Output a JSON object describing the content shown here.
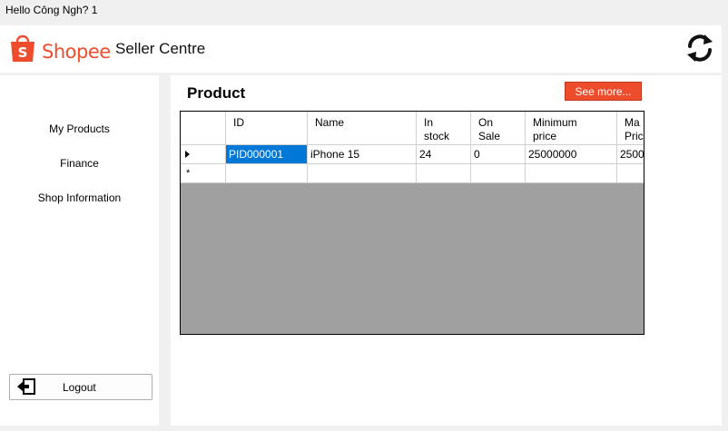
{
  "window": {
    "title": "Hello Công Ngh? 1"
  },
  "header": {
    "logo_text": "Shopee",
    "app_name": "Seller Centre",
    "refresh_icon": "refresh-icon"
  },
  "sidebar": {
    "items": [
      {
        "label": "My Products"
      },
      {
        "label": "Finance"
      },
      {
        "label": "Shop Information"
      }
    ],
    "logout_label": "Logout"
  },
  "main": {
    "title": "Product",
    "see_more_label": "See more...",
    "grid": {
      "columns": [
        "ID",
        "Name",
        "In\nstock",
        "On\nSale",
        "Minimum\nprice",
        "Ma\nPric"
      ],
      "rows": [
        {
          "cells": [
            "PID000001",
            "iPhone 15",
            "24",
            "0",
            "25000000",
            "2500"
          ]
        }
      ],
      "new_row_marker": "*"
    }
  },
  "colors": {
    "brand": "#ee4d2d",
    "selection": "#0078d7",
    "grid_bg": "#a0a0a0"
  }
}
